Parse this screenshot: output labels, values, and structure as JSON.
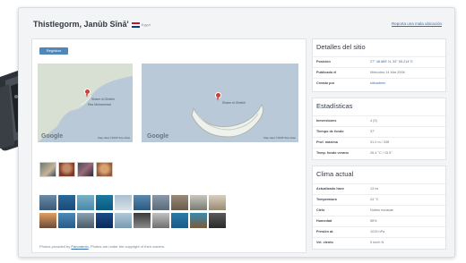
{
  "page": {
    "title": "Thistlegorm, Janūb Sīnā'",
    "country": "Egypt",
    "top_link": "Reporta una mala ubicación"
  },
  "toolbar": {
    "button_label": "Registrar"
  },
  "maps": {
    "google_label": "Google",
    "map_data": "Map data ©2008 Tele Atlas",
    "map1_labels": [
      "Sharm el-Sheikh",
      "Ras Muhammad"
    ],
    "map2_labels": [
      "Sharm el-Sheikh"
    ]
  },
  "photos": {
    "credit_prefix": "Photos provided by",
    "credit_link": "Panoramio",
    "credit_suffix": ". Photos are under the copyright of their owners."
  },
  "details": {
    "title": "Detalles del sitio",
    "rows": [
      {
        "label": "Posición",
        "value": "27° 48.889' N, 33° 55.214' E",
        "link": true
      },
      {
        "label": "Publicado el",
        "value": "Miércoles 14 Mar 2008",
        "link": false
      },
      {
        "label": "Creado por",
        "value": "sitioadmin",
        "link": true
      }
    ]
  },
  "stats": {
    "title": "Estadísticas",
    "rows": [
      {
        "label": "Inmersiones",
        "value": "4 (3)"
      },
      {
        "label": "Tiempo de fondo",
        "value": "37'"
      },
      {
        "label": "Prof. máxima",
        "value": "31.0 m / 33ft"
      },
      {
        "label": "Temp. fondo verano",
        "value": "26.4 °C / 15.5°"
      }
    ]
  },
  "weather": {
    "title": "Clima actual",
    "rows": [
      {
        "label": "Actualizado hace",
        "value": "13 hs"
      },
      {
        "label": "Temperatura",
        "value": "24 °C"
      },
      {
        "label": "Cielo",
        "value": "Nubes escasas"
      },
      {
        "label": "Humedad",
        "value": "56%"
      },
      {
        "label": "Presión at.",
        "value": "1015 hPa"
      },
      {
        "label": "Vel. viento",
        "value": "5 km/h N"
      }
    ]
  },
  "colors": {
    "accent": "#4f87b8",
    "link": "#3a6fb0",
    "background": "#f3f4f6",
    "map": "#b9c9d8"
  },
  "icons": {
    "flag": "egypt-flag-icon",
    "pin": "map-pin-icon"
  }
}
